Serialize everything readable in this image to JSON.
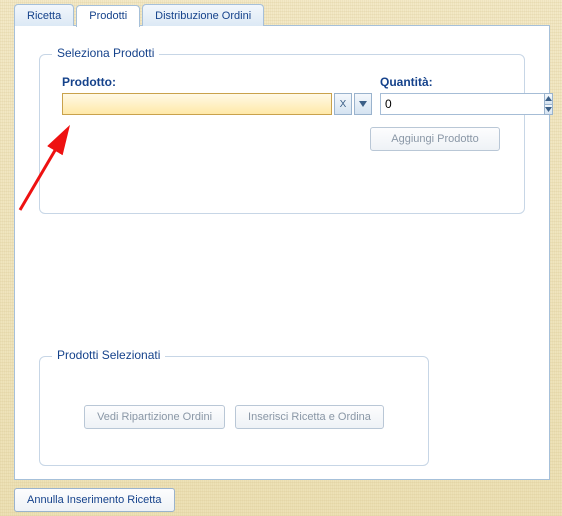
{
  "tabs": {
    "ricetta": "Ricetta",
    "prodotti": "Prodotti",
    "distribuzione": "Distribuzione Ordini"
  },
  "seleziona": {
    "legend": "Seleziona Prodotti",
    "prodotto_label": "Prodotto:",
    "prodotto_value": "",
    "clear_label": "X",
    "quantita_label": "Quantità:",
    "quantita_value": "0",
    "aggiungi_label": "Aggiungi Prodotto"
  },
  "selezionati": {
    "legend": "Prodotti Selezionati",
    "vedi_label": "Vedi Ripartizione Ordini",
    "inserisci_label": "Inserisci Ricetta e Ordina"
  },
  "footer": {
    "annulla_label": "Annulla Inserimento Ricetta"
  }
}
